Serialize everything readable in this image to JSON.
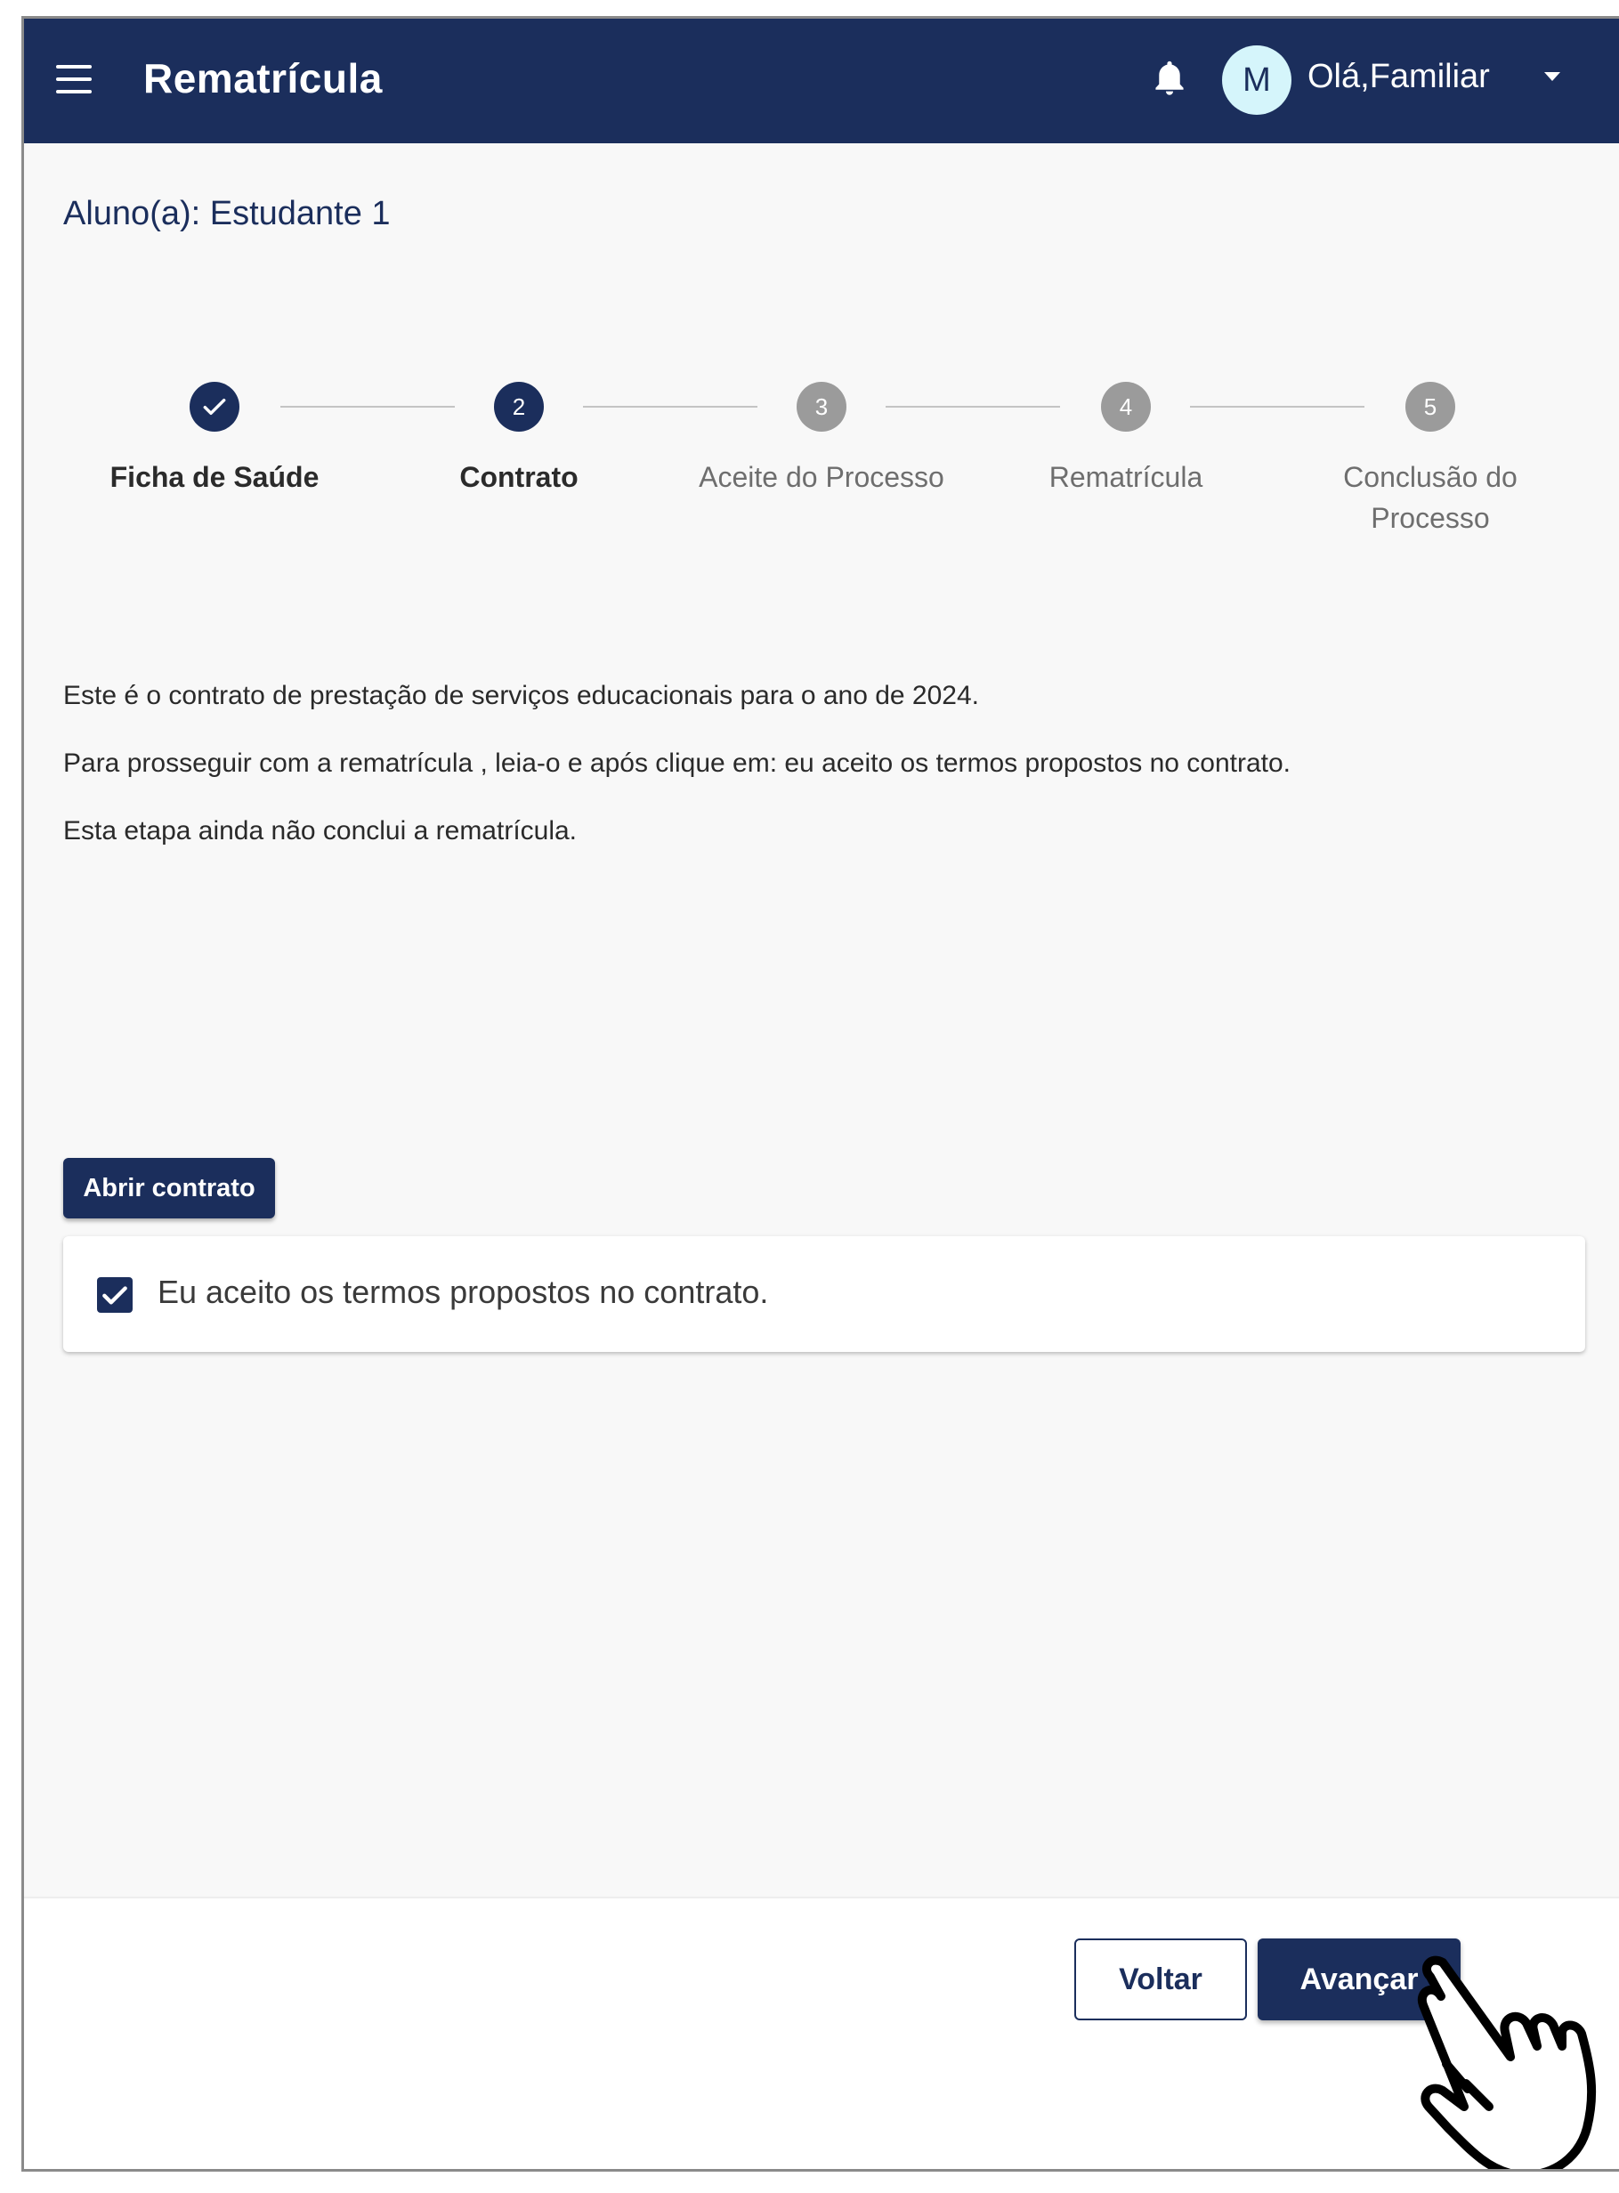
{
  "header": {
    "title": "Rematrícula",
    "avatar_initial": "M",
    "greeting": "Olá,Familiar",
    "brand_color": "#1b2e5c"
  },
  "student": {
    "label": "Aluno(a): Estudante 1"
  },
  "stepper": {
    "steps": [
      {
        "number": "",
        "label_line1": "Ficha de Saúde",
        "label_line2": "",
        "state": "done"
      },
      {
        "number": "2",
        "label_line1": "Contrato",
        "label_line2": "",
        "state": "active"
      },
      {
        "number": "3",
        "label_line1": "Aceite do Processo",
        "label_line2": "",
        "state": "todo"
      },
      {
        "number": "4",
        "label_line1": "Rematrícula",
        "label_line2": "",
        "state": "todo"
      },
      {
        "number": "5",
        "label_line1": "Conclusão do",
        "label_line2": "Processo",
        "state": "todo"
      }
    ]
  },
  "content": {
    "paragraph1": "Este é o contrato de prestação de serviços educacionais para o ano de 2024.",
    "paragraph2": "Para prosseguir com a rematrícula , leia-o e após clique em: eu aceito os termos propostos no contrato.",
    "paragraph3": "Esta etapa ainda não conclui a rematrícula.",
    "open_contract_label": "Abrir contrato",
    "accept_label": "Eu aceito os termos propostos no contrato.",
    "accept_checked": true
  },
  "footer": {
    "back_label": "Voltar",
    "next_label": "Avançar"
  },
  "icons": {
    "menu": "menu-icon",
    "bell": "bell-icon",
    "caret": "chevron-down-icon",
    "check": "check-icon",
    "cursor": "hand-pointer-icon"
  }
}
